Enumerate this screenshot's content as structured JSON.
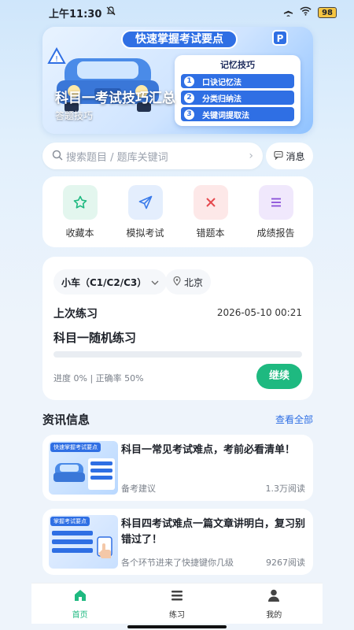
{
  "status": {
    "time": "上午11:30",
    "battery": "98"
  },
  "banner": {
    "pill": "快速掌握考试要点",
    "card_title": "记忆技巧",
    "tips": [
      {
        "num": "1",
        "text": "口诀记忆法"
      },
      {
        "num": "2",
        "text": "分类归纳法"
      },
      {
        "num": "3",
        "text": "关键词提取法"
      }
    ],
    "title": "科目一考试技巧汇总",
    "subtitle": "答题技巧"
  },
  "search": {
    "placeholder": "搜索题目 / 题库关键词"
  },
  "message_label": "消息",
  "quick_actions": [
    {
      "label": "收藏本",
      "icon": "star-icon",
      "color": "#1eb980",
      "bg": "#e3f6ee"
    },
    {
      "label": "模拟考试",
      "icon": "paper-plane-icon",
      "color": "#3a7bea",
      "bg": "#e4eefd"
    },
    {
      "label": "错题本",
      "icon": "close-x-icon",
      "color": "#e5484d",
      "bg": "#fde8e8"
    },
    {
      "label": "成绩报告",
      "icon": "list-icon",
      "color": "#8a4fd8",
      "bg": "#f0e8fc"
    }
  ],
  "practice": {
    "car_type": "小车（C1/C2/C3）",
    "city": "北京",
    "last_label": "上次练习",
    "last_time": "2026-05-10 00:21",
    "title": "科目一随机练习",
    "progress": 0,
    "stats": "进度 0% | 正确率 50%",
    "continue_label": "继续"
  },
  "news": {
    "title": "资讯信息",
    "more": "查看全部",
    "items": [
      {
        "thumb_label": "快速掌握考试要点",
        "headline": "科目一常见考试难点，考前必看清单！",
        "source": "备考建议",
        "reads": "1.3万阅读"
      },
      {
        "thumb_label": "掌握考试要点",
        "headline": "科目四考试难点一篇文章讲明白，复习别错过了！",
        "source": "各个环节进来了快捷键你几级",
        "reads": "9267阅读"
      }
    ]
  },
  "tabs": [
    {
      "label": "首页",
      "icon": "home-icon",
      "active": true
    },
    {
      "label": "练习",
      "icon": "menu-icon",
      "active": false
    },
    {
      "label": "我的",
      "icon": "user-icon",
      "active": false
    }
  ],
  "colors": {
    "accent": "#1eb980",
    "brand_blue": "#2f6fe4"
  }
}
